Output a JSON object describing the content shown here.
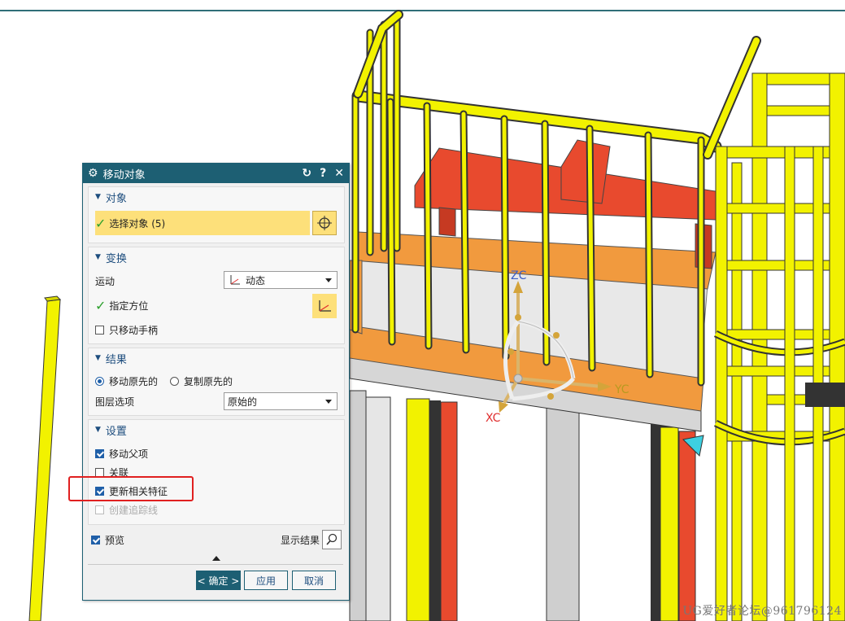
{
  "scene": {
    "axis_labels": {
      "zc": "ZC",
      "yc": "YC",
      "xc": "XC"
    },
    "watermark": "UG爱好者论坛@961796124",
    "colors": {
      "railing": "#f2f200",
      "bench": "#e84a2e",
      "deck": "#f19a3e",
      "floor": "#e8e8e8",
      "steel": "#cfcfcf",
      "dark": "#333333"
    }
  },
  "dialog": {
    "title": "移动对象",
    "title_icons": [
      "gear-icon",
      "reset-icon",
      "help-icon",
      "close-icon"
    ],
    "sections": {
      "object": {
        "label": "对象",
        "select_label": "选择对象 (5)"
      },
      "transform": {
        "label": "变换",
        "motion_label": "运动",
        "motion_value": "动态",
        "orient_label": "指定方位",
        "only_handle_label": "只移动手柄"
      },
      "result": {
        "label": "结果",
        "move_original": "移动原先的",
        "copy_original": "复制原先的",
        "layer_label": "图层选项",
        "layer_value": "原始的"
      },
      "settings": {
        "label": "设置",
        "move_parent": "移动父项",
        "associate": "关联",
        "update_features": "更新相关特征",
        "create_trace": "创建追踪线"
      }
    },
    "preview_label": "预览",
    "show_result_label": "显示结果",
    "buttons": {
      "ok": "< 确定 >",
      "apply": "应用",
      "cancel": "取消"
    }
  }
}
